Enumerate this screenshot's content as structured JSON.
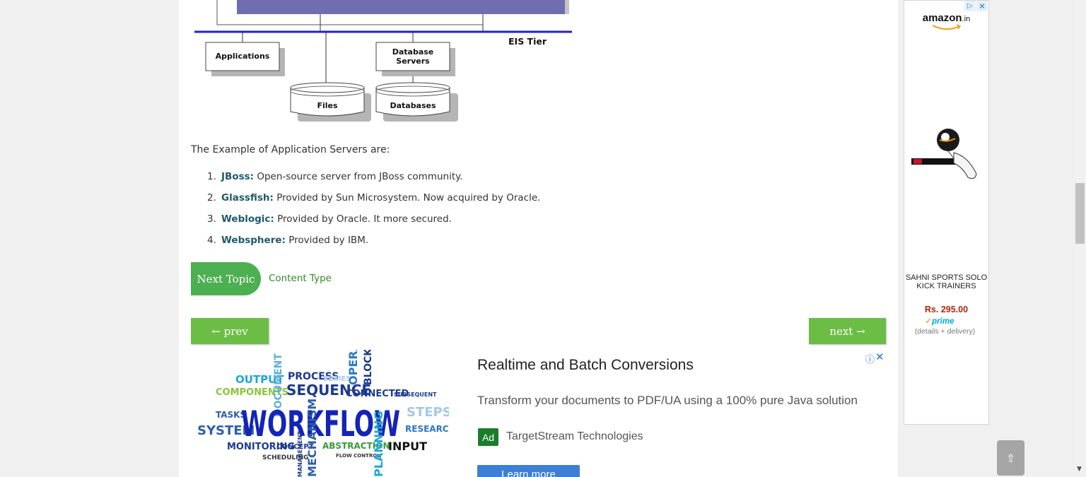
{
  "diagram": {
    "tier_label": "EIS Tier",
    "nodes": {
      "applications": "Applications",
      "database_servers_line1": "Database",
      "database_servers_line2": "Servers",
      "files": "Files",
      "databases": "Databases"
    }
  },
  "content": {
    "intro": "The Example of Application Servers are:",
    "servers": [
      {
        "num": "1.",
        "name": "JBoss:",
        "desc": " Open-source server from JBoss community."
      },
      {
        "num": "2.",
        "name": "Glassfish:",
        "desc": " Provided by Sun Microsystem. Now acquired by Oracle."
      },
      {
        "num": "3.",
        "name": "Weblogic:",
        "desc": " Provided by Oracle. It more secured."
      },
      {
        "num": "4.",
        "name": "Websphere:",
        "desc": " Provided by IBM."
      }
    ],
    "next_topic_label": "Next Topic",
    "next_topic_link": "Content Type",
    "prev_label": "← prev",
    "next_label": "next →"
  },
  "bottom_ad": {
    "wordcloud_words": [
      "OUTPUT",
      "COMPONENTS",
      "DOCUMENT",
      "PROCESS",
      "SERIES",
      "SEQUENCE",
      "OPERA",
      "BLOCK",
      "CONNECTED",
      "SUBSEQUENT",
      "TASKS",
      "SYSTEM",
      "WORKFLOW",
      "STEPS",
      "RESEARCH",
      "MONITORING",
      "CONCEPT",
      "ABSTRACTION",
      "INPUT",
      "SCHEDULING",
      "FLOW CONTROL",
      "MANAGEMENT",
      "MECHANISM",
      "PLANNING"
    ],
    "title": "Realtime and Batch Conversions",
    "description": "Transform your documents to PDF/UA using a 100% pure Java solution",
    "badge": "Ad",
    "advertiser": "TargetStream Technologies",
    "cta": "Learn more",
    "info_icon": "ⓘ",
    "close_icon": "✕"
  },
  "side_ad": {
    "logo_brand": "amazon",
    "logo_tld": ".in",
    "adchoices_icon": "▷",
    "close_icon": "✕",
    "product_name": "SAHNI SPORTS SOLO KICK TRAINERS",
    "price": "Rs. 295.00",
    "prime_check": "✓",
    "prime": "prime",
    "details": "(details + delivery)"
  },
  "scroll_top_icon": "⇧",
  "colors": {
    "accent_green": "#4caf50",
    "nav_green": "#6cbd45",
    "link_green": "#2e8b22",
    "diagram_blue": "#1f1fd6",
    "diagram_purple": "#6e6eb0"
  }
}
